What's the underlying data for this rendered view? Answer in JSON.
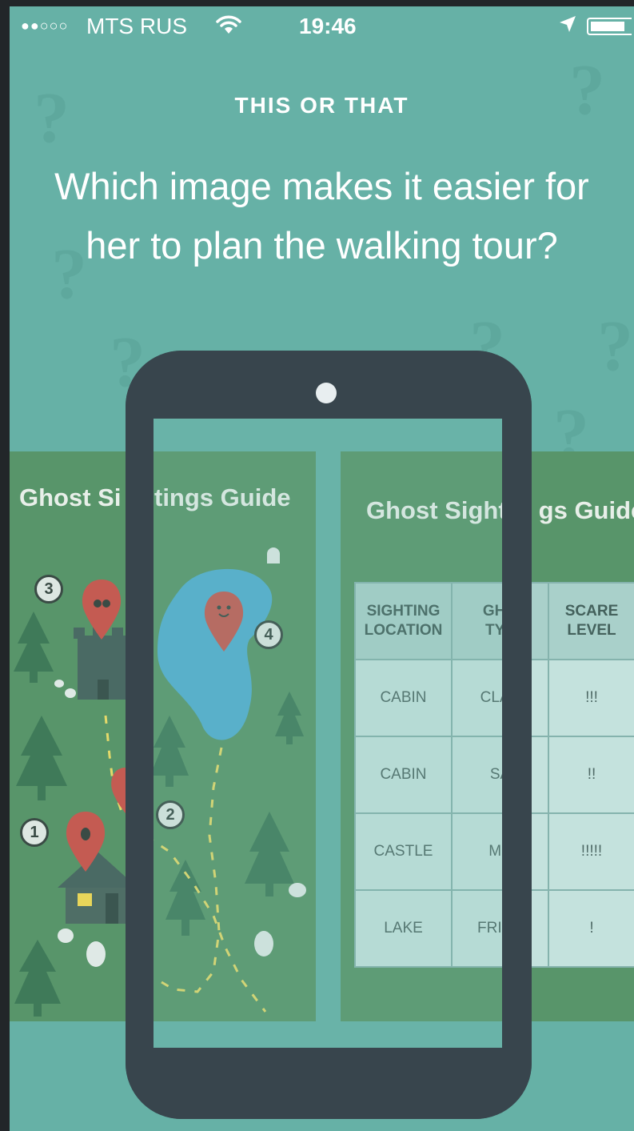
{
  "status_bar": {
    "signal": "●●○○○",
    "carrier": "MTS RUS",
    "wifi_icon": "wifi-icon",
    "time": "19:46",
    "location_icon": "location-arrow-icon",
    "battery_icon": "battery-icon"
  },
  "header": {
    "kicker": "THIS OR THAT",
    "question": "Which image makes it easier for her to plan the walking tour?"
  },
  "left_option": {
    "title_part1": "Ghost Si",
    "title_part2": "tings Guide",
    "map_numbers": [
      "1",
      "2",
      "3",
      "4"
    ]
  },
  "right_option": {
    "title_part1": "Ghost Sight",
    "title_part2": "gs Guide",
    "columns": [
      {
        "line1": "SIGHTING",
        "line2": "LOCATION"
      },
      {
        "line1": "GHO",
        "line2": "TYP"
      },
      {
        "line1": "SCARE",
        "line2": "LEVEL"
      }
    ],
    "rows": [
      [
        "CABIN",
        "CLAS",
        "!!!"
      ],
      [
        "CABIN",
        "SA",
        "!!"
      ],
      [
        "CASTLE",
        "ME",
        "!!!!!"
      ],
      [
        "LAKE",
        "FRIEN",
        "!"
      ]
    ]
  },
  "colors": {
    "background": "#66b1a6",
    "card": "#58956a",
    "phone": "#38454d",
    "lake": "#52aed0",
    "pin": "#c45b52"
  }
}
